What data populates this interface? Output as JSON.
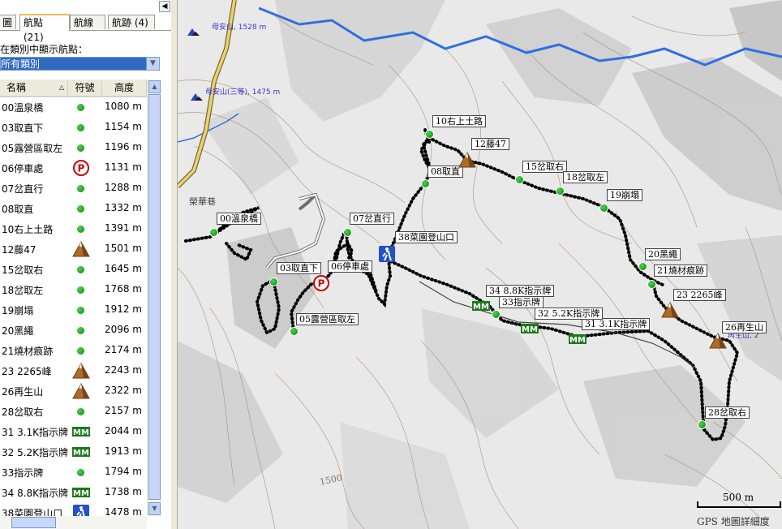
{
  "tabs": [
    {
      "label": "圖"
    },
    {
      "label": "航點 (21)"
    },
    {
      "label": "航線"
    },
    {
      "label": "航跡 (4)"
    }
  ],
  "filter": {
    "label": "在類別中顯示航點：",
    "selected": "所有類別"
  },
  "columns": {
    "name": "名稱",
    "symbol": "符號",
    "altitude": "高度"
  },
  "waypoints": [
    {
      "name": "00溫泉橋",
      "symbol": "dot",
      "altitude": "1080 m"
    },
    {
      "name": "03取直下",
      "symbol": "dot",
      "altitude": "1154 m"
    },
    {
      "name": "05露營區取左",
      "symbol": "dot",
      "altitude": "1196 m"
    },
    {
      "name": "06停車處",
      "symbol": "parking",
      "altitude": "1131 m"
    },
    {
      "name": "07岔直行",
      "symbol": "dot",
      "altitude": "1288 m"
    },
    {
      "name": "08取直",
      "symbol": "dot",
      "altitude": "1332 m"
    },
    {
      "name": "10右上土路",
      "symbol": "dot",
      "altitude": "1391 m"
    },
    {
      "name": "12藤47",
      "symbol": "summit",
      "altitude": "1501 m"
    },
    {
      "name": "15岔取右",
      "symbol": "dot",
      "altitude": "1645 m"
    },
    {
      "name": "18岔取左",
      "symbol": "dot",
      "altitude": "1768 m"
    },
    {
      "name": "19崩塌",
      "symbol": "dot",
      "altitude": "1912 m"
    },
    {
      "name": "20黑繩",
      "symbol": "dot",
      "altitude": "2096 m"
    },
    {
      "name": "21燒材痕跡",
      "symbol": "dot",
      "altitude": "2174 m"
    },
    {
      "name": "23 2265峰",
      "symbol": "summit",
      "altitude": "2243 m"
    },
    {
      "name": "26再生山",
      "symbol": "summit",
      "altitude": "2322 m"
    },
    {
      "name": "28岔取右",
      "symbol": "dot",
      "altitude": "2157 m"
    },
    {
      "name": "31 3.1K指示牌",
      "symbol": "milemarker",
      "altitude": "2044 m"
    },
    {
      "name": "32 5.2K指示牌",
      "symbol": "milemarker",
      "altitude": "1913 m"
    },
    {
      "name": "33指示牌",
      "symbol": "dot",
      "altitude": "1794 m"
    },
    {
      "name": "34 8.8K指示牌",
      "symbol": "milemarker",
      "altitude": "1738 m"
    },
    {
      "name": "38菜園登山口",
      "symbol": "trailhead",
      "altitude": "1478 m"
    }
  ],
  "map": {
    "peak_labels": [
      {
        "text": "母安山, 1528 m"
      },
      {
        "text": "母安山(三等), 1475 m"
      },
      {
        "text": "再生山, 2"
      }
    ],
    "waypoint_labels": [
      {
        "text": "00溫泉橋"
      },
      {
        "text": "03取直下"
      },
      {
        "text": "05露營區取左"
      },
      {
        "text": "06停車處"
      },
      {
        "text": "07岔直行"
      },
      {
        "text": "08取直"
      },
      {
        "text": "10右上土路"
      },
      {
        "text": "12藤47"
      },
      {
        "text": "15岔取右"
      },
      {
        "text": "18岔取左"
      },
      {
        "text": "19崩塌"
      },
      {
        "text": "20黑繩"
      },
      {
        "text": "21燒材痕跡"
      },
      {
        "text": "23 2265峰"
      },
      {
        "text": "26再生山"
      },
      {
        "text": "28岔取右"
      },
      {
        "text": "31 3.1K指示牌"
      },
      {
        "text": "32 5.2K指示牌"
      },
      {
        "text": "33指示牌"
      },
      {
        "text": "34 8.8K指示牌"
      },
      {
        "text": "38菜園登山口"
      }
    ],
    "place_label": "榮華巷",
    "contour_label": "1500",
    "scale_text": "500 m",
    "detail_text": "GPS 地圖詳細度"
  }
}
